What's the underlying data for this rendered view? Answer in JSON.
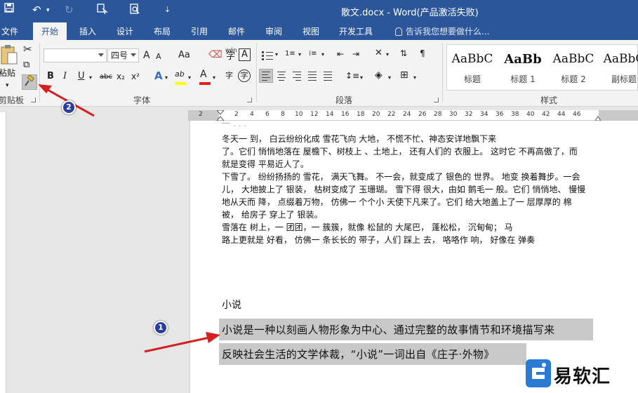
{
  "window": {
    "title": "散文.docx - Word(产品激活失败)"
  },
  "tabs": [
    {
      "label": "文件"
    },
    {
      "label": "开始"
    },
    {
      "label": "插入"
    },
    {
      "label": "设计"
    },
    {
      "label": "布局"
    },
    {
      "label": "引用"
    },
    {
      "label": "邮件"
    },
    {
      "label": "审阅"
    },
    {
      "label": "视图"
    },
    {
      "label": "开发工具"
    }
  ],
  "active_tab": "开始",
  "tell_me": "告诉我您想要做什么...",
  "ribbon": {
    "clipboard": {
      "paste_label": "粘贴",
      "group_label": "剪贴板"
    },
    "font": {
      "font_name_value": "",
      "font_size_value": "四号",
      "group_label": "字体",
      "grow": "A",
      "shrink": "A",
      "case": "Aa",
      "phonetic": "wén",
      "bold": "B",
      "italic": "I",
      "underline": "U",
      "strike": "abc",
      "subscript": "x₂",
      "superscript": "x²",
      "text_effect": "A",
      "highlight": "ab",
      "font_color": "A",
      "enclose": "字",
      "char_border": "A"
    },
    "paragraph": {
      "group_label": "段落"
    },
    "styles": {
      "group_label": "样式",
      "items": [
        {
          "sample": "AaBbC",
          "name": "标题"
        },
        {
          "sample": "AaBb",
          "name": "标题 1"
        },
        {
          "sample": "AaBbC",
          "name": "标题 2"
        },
        {
          "sample": "AaBbC",
          "name": "副标题"
        }
      ]
    }
  },
  "ruler": {
    "ticks": [
      "2",
      "2",
      "4",
      "6",
      "8",
      "10",
      "12",
      "14",
      "16",
      "18",
      "20",
      "22",
      "24",
      "26",
      "28",
      "30",
      "32",
      "34",
      "36",
      "38",
      "40",
      "42",
      "44",
      "46"
    ]
  },
  "document": {
    "lines": [
      "冬天一 到， 白云纷纷化成 雪花飞向 大地， 不慌不忙、神态安详地飘下来",
      "了。它们 悄悄地落在 屋檐下、树枝上 、土地上， 还有人们的 衣服上。 这时它 不再高傲了，而",
      "就是变得 平易近人了。",
      "下雪了。 纷纷扬扬的 雪花， 满天飞舞。 不一会，就变成了 银色的 世界。 地变 换着舞步。一会",
      "儿， 大地披上了 银装， 枯树变成了 玉珊瑚。 雪下得 很大，由如 鹅毛一 般。它们 悄悄地、 慢慢",
      "地从天而 降， 点缀着万物， 仿佛一 个个小 天使下凡来了。它们 给大地盖上了一 层厚厚的 棉",
      "被， 给房子 穿上了 银装。",
      "雪落在 树上，一 团团，一 簇簇，就像 松鼠的 大尾巴， 蓬松松， 沉甸甸； 马",
      "路上更就是 好看， 仿佛一 条长长的 带子，人们 踩上 去， 咯咯作 响， 好像在 弹奏"
    ],
    "heading": "小说",
    "selected_lines": [
      "小说是一种以刻画人物形象为中心、通过完整的故事情节和环境描写来",
      "反映社会生活的文学体裁，“小说”一词出自《庄子·外物》"
    ]
  },
  "annotations": {
    "marker_1": "1",
    "marker_2": "2",
    "arrow_color": "#d42020",
    "marker_color": "#2b3e9c"
  },
  "watermark": {
    "text": "易软汇"
  },
  "colors": {
    "title_bar": "#2b579a",
    "ribbon_bg": "#f3f3f3",
    "selection": "#c8c8c8"
  }
}
